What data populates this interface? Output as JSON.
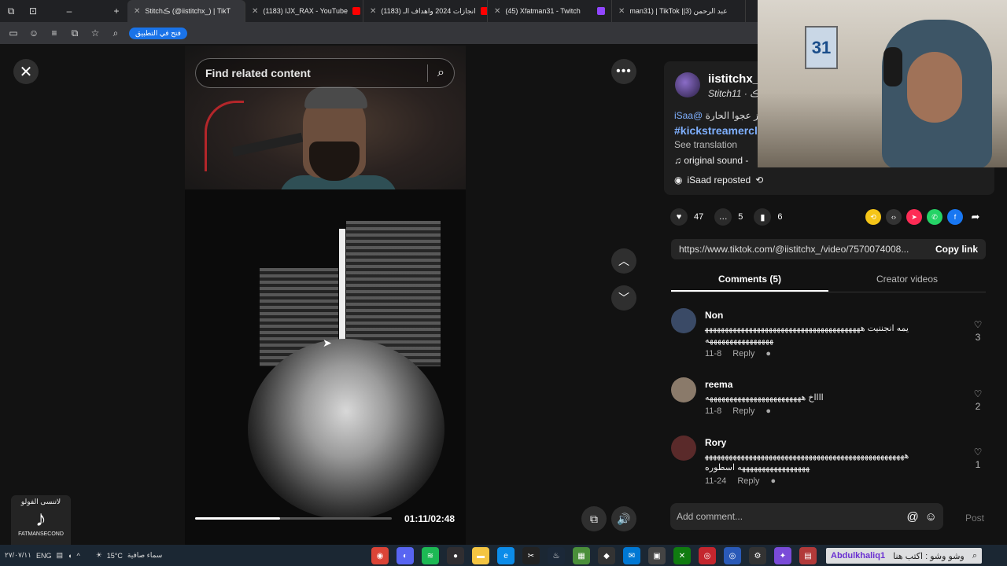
{
  "browser": {
    "tabs": [
      {
        "label": "Stitchڪ (@iistitchx_) | TikT",
        "color": "#111111",
        "active": true
      },
      {
        "label": "(1183) IJX_RAX - YouTube",
        "color": "#ff0000"
      },
      {
        "label": "(1183) انجازات 2024 واهداف الـ",
        "color": "#ff0000"
      },
      {
        "label": "(45) Xfatman31 - Twitch",
        "color": "#9146ff"
      },
      {
        "label": "man31) | TikTok ||عبد الرحمن (3",
        "color": "#111111"
      }
    ],
    "open_in_app": "فتح في التطبيق"
  },
  "player": {
    "search_placeholder": "Find related content",
    "progress_fraction": 0.43,
    "timecode": "01:11/02:48"
  },
  "post": {
    "username": "iistitchx_",
    "subline": "Stitchڪ · 11",
    "description_ar": "از عجوا الحارة",
    "mention": "@iSaa",
    "hashtag": "#kickstreamercli",
    "see_translation": "See translation",
    "sound": "original sound -",
    "reposted": "iSaad reposted",
    "likes": "47",
    "comments_count": "5",
    "saves": "6",
    "link_url": "https://www.tiktok.com/@iistitchx_/video/7570074008...",
    "copy_link": "Copy link"
  },
  "tabs": {
    "comments": "Comments (5)",
    "creator_videos": "Creator videos"
  },
  "comments": [
    {
      "name": "Non",
      "text": "يمه انجننيت ههههههههههههههههههههههههههههههههههههههههههههههههههههههههه",
      "date": "11-8",
      "reply": "Reply",
      "likes": "3",
      "avatar_color": "#3a4a66"
    },
    {
      "name": "reema",
      "text": "ااااخ ههههههههههههههههههههههههه",
      "date": "11-8",
      "reply": "Reply",
      "likes": "2",
      "avatar_color": "#8a7a6a"
    },
    {
      "name": "Rory",
      "text": "ههههههههههههههههههههههههههههههههههههههههههههههههههههههههههههههههههههه اسطوره",
      "date": "11-24",
      "reply": "Reply",
      "likes": "1",
      "avatar_color": "#5a2a2a"
    }
  ],
  "add_comment": {
    "placeholder": "Add comment...",
    "post": "Post"
  },
  "watermark": {
    "top": "لاتنسى الفولو",
    "bottom": "FATMANSECOND"
  },
  "taskbar": {
    "weather_temp": "15°C",
    "weather_desc": "سماء صافية",
    "date": "٢٧/٠٧/١١",
    "chat_user": "Abdulkhaliq1",
    "chat_text": "وشو وشو : اكتب هنا"
  }
}
